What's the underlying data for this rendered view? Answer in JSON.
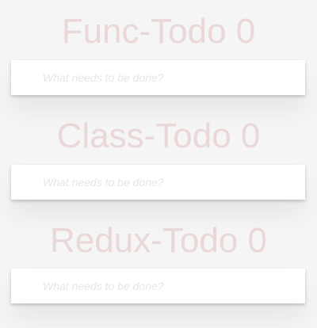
{
  "sections": [
    {
      "title": "Func-Todo 0",
      "input_placeholder": "What needs to be done?",
      "input_value": ""
    },
    {
      "title": "Class-Todo 0",
      "input_placeholder": "What needs to be done?",
      "input_value": ""
    },
    {
      "title": "Redux-Todo 0",
      "input_placeholder": "What needs to be done?",
      "input_value": ""
    }
  ]
}
